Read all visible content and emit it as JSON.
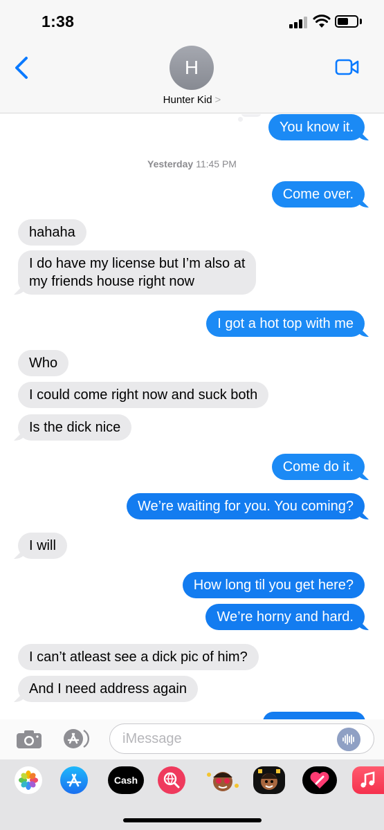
{
  "status": {
    "time": "1:38"
  },
  "header": {
    "avatar_initial": "H",
    "contact_name": "Hunter Kid",
    "chevron": ">"
  },
  "messages": [
    {
      "from": "me",
      "text": "You know it."
    },
    {
      "timestamp_day": "Yesterday",
      "timestamp_time": "11:45 PM"
    },
    {
      "from": "me",
      "text": "Come over."
    },
    {
      "from": "them",
      "text": "hahaha"
    },
    {
      "from": "them",
      "text_line1": "I do have my license but I’m also at",
      "text_line2": "my friends house right now"
    },
    {
      "from": "me",
      "text": "I got a hot top with me"
    },
    {
      "from": "them",
      "text": "Who"
    },
    {
      "from": "them",
      "text": "I could come right now and suck both"
    },
    {
      "from": "them",
      "text": "Is the dick nice"
    },
    {
      "from": "me",
      "text": "Come do it."
    },
    {
      "from": "me",
      "text": "We’re waiting for you. You coming?"
    },
    {
      "from": "them",
      "text": "I will"
    },
    {
      "from": "me",
      "text": "How long til you get here?"
    },
    {
      "from": "me",
      "text": "We’re horny and hard."
    },
    {
      "from": "them",
      "text": "I can’t atleast see a dick pic of him?"
    },
    {
      "from": "them",
      "text": "And I need address again"
    }
  ],
  "compose": {
    "placeholder": "iMessage"
  },
  "app_drawer": {
    "items": [
      "photos-app",
      "app-store-app",
      "cash-app",
      "web-images-app",
      "memoji-stickers-app",
      "memoji-app",
      "digital-touch-app",
      "music-app"
    ],
    "cash_label": "Cash"
  },
  "colors": {
    "outgoing": "#1b8af5",
    "incoming": "#e9e9eb",
    "accent": "#0a7aff"
  }
}
